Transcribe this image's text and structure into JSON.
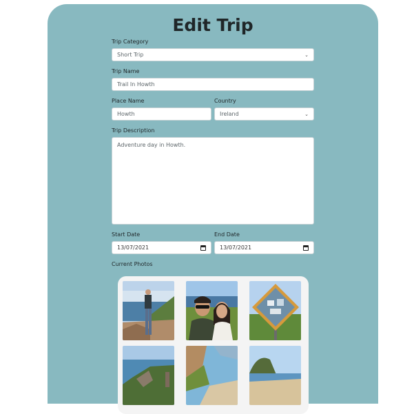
{
  "page": {
    "title": "Edit Trip"
  },
  "form": {
    "trip_category": {
      "label": "Trip Category",
      "value": "Short Trip"
    },
    "trip_name": {
      "label": "Trip Name",
      "value": "Trail In Howth"
    },
    "place_name": {
      "label": "Place Name",
      "value": "Howth"
    },
    "country": {
      "label": "Country",
      "value": "Ireland"
    },
    "description": {
      "label": "Trip Description",
      "value": "Adventure day in Howth."
    },
    "start_date": {
      "label": "Start Date",
      "value": "13/07/2021"
    },
    "end_date": {
      "label": "End Date",
      "value": "13/07/2021"
    },
    "photos_label": "Current Photos"
  },
  "colors": {
    "card": "#88b9c0",
    "photo_panel": "#f4f4f4",
    "title_text": "#1f2628"
  },
  "icons": {
    "select": "chevron-down-icon",
    "date": "calendar-icon"
  }
}
